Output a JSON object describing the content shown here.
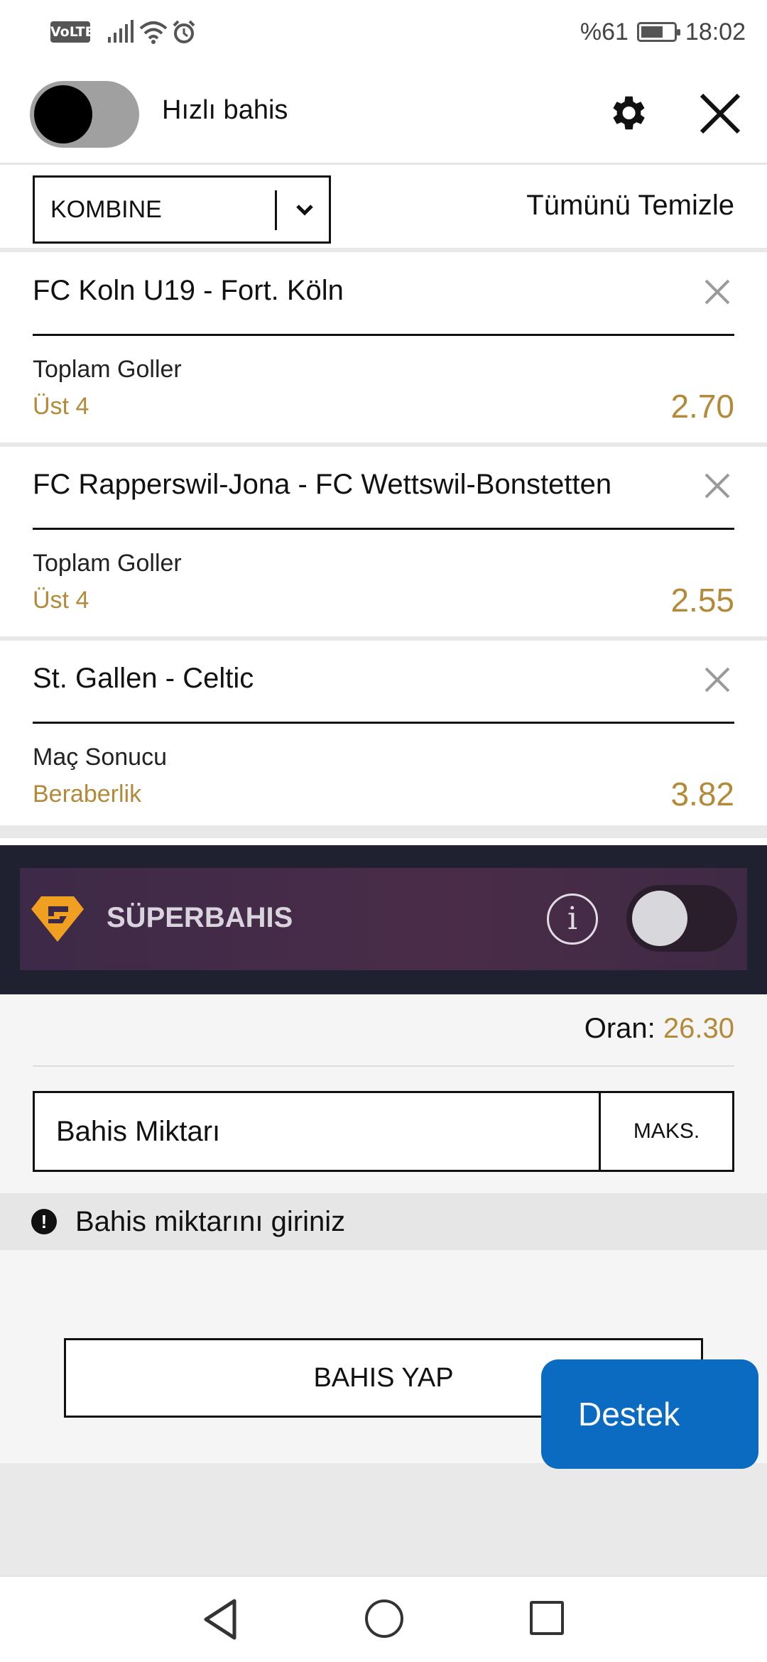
{
  "status": {
    "volte": "VoLTE",
    "battery": "%61",
    "time": "18:02"
  },
  "header": {
    "quick_bet_label": "Hızlı bahis",
    "quick_bet_on": true
  },
  "betslip": {
    "type_selected": "KOMBINE",
    "clear_all": "Tümünü Temizle",
    "items": [
      {
        "match": "FC Koln U19 - Fort. Köln",
        "market": "Toplam Goller",
        "selection": "Üst 4",
        "odds": "2.70"
      },
      {
        "match": "FC Rapperswil-Jona - FC Wettswil-Bonstetten",
        "market": "Toplam Goller",
        "selection": "Üst 4",
        "odds": "2.55"
      },
      {
        "match": "St. Gallen - Celtic",
        "market": "Maç Sonucu",
        "selection": "Beraberlik",
        "odds": "3.82"
      }
    ]
  },
  "superbahis": {
    "label": "SÜPERBAHIS",
    "info_glyph": "i",
    "enabled": false
  },
  "summary": {
    "odds_label": "Oran:",
    "odds_value": "26.30",
    "stake_placeholder": "Bahis Miktarı",
    "max_label": "MAKS.",
    "warning_text": "Bahis miktarını giriniz",
    "place_bet_label": "BAHIS YAP"
  },
  "support_label": "Destek",
  "colors": {
    "odds_gold": "#b38a3a",
    "support_blue": "#0b6bc1",
    "super_panel": "#4a2c48"
  }
}
